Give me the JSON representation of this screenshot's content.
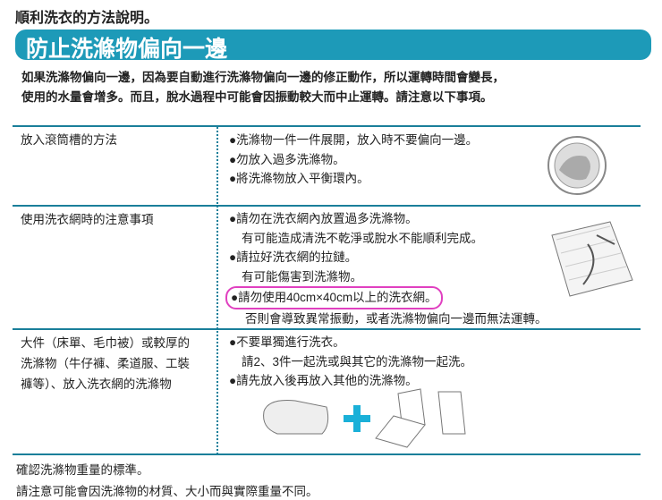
{
  "header": "順利洗衣的方法說明。",
  "title": "防止洗滌物偏向一邊",
  "intro": [
    "如果洗滌物偏向一邊，因為要自動進行洗滌物偏向一邊的修正動作，所以運轉時間會變長，",
    "使用的水量會增多。而且，脫水過程中可能會因振動較大而中止運轉。請注意以下事項。"
  ],
  "rows": [
    {
      "label": "放入滾筒槽的方法",
      "lines": [
        "●洗滌物一件一件展開，放入時不要偏向一邊。",
        "●勿放入過多洗滌物。",
        "●將洗滌物放入平衡環內。"
      ]
    },
    {
      "label": "使用洗衣網時的注意事項",
      "lines": [
        "●請勿在洗衣網內放置過多洗滌物。",
        "有可能造成清洗不乾淨或脫水不能順利完成。",
        "●請拉好洗衣網的拉鏈。",
        "有可能傷害到洗滌物。",
        "●請勿使用40cm×40cm以上的洗衣網。",
        "否則會導致異常振動，或者洗滌物偏向一邊而無法運轉。"
      ]
    },
    {
      "label": [
        "大件（床單、毛巾被）或較厚的",
        "洗滌物（牛仔褲、柔道服、工裝",
        "褲等）、放入洗衣網的洗滌物"
      ],
      "lines": [
        "●不要單獨進行洗衣。",
        "請2、3件一起洗或與其它的洗滌物一起洗。",
        "●請先放入後再放入其他的洗滌物。"
      ]
    }
  ],
  "footer": [
    "確認洗滌物重量的標準。",
    "請注意可能會因洗滌物的材質、大小而與實際重量不同。"
  ],
  "colors": {
    "accent": "#1d9ab8",
    "highlight": "#e040c0"
  }
}
